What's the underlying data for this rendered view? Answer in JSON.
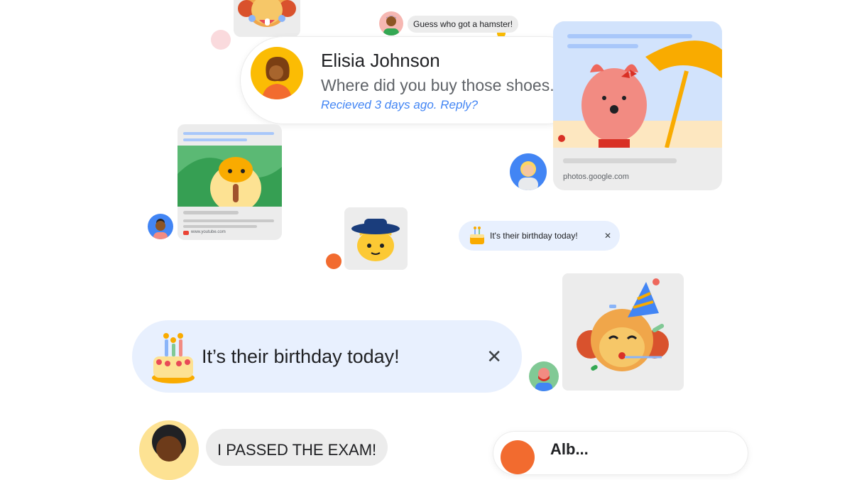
{
  "top_bubble": {
    "text": "Guess who got a hamster!"
  },
  "notification": {
    "sender": "Elisia Johnson",
    "preview": "Where did you buy those shoes...",
    "meta": "Recieved 3 days ago. Reply?"
  },
  "photo_card": {
    "domain": "photos.google.com"
  },
  "youtube_card": {
    "domain": "www.youtube.com"
  },
  "small_birthday": {
    "text": "It's their birthday today!",
    "close": "✕"
  },
  "big_birthday": {
    "text": "It’s their birthday today!",
    "close": "✕"
  },
  "bottom_bubble": {
    "text": "I PASSED THE EXAM!"
  },
  "bottom_right_bubble": {
    "text": "Alb..."
  },
  "colors": {
    "accent_blue": "#4285f4",
    "bubble_blue": "#e8f0fe",
    "card_gray": "#ececec",
    "orange_dot": "#f26b2f",
    "pink_dot": "#f8d7da"
  }
}
